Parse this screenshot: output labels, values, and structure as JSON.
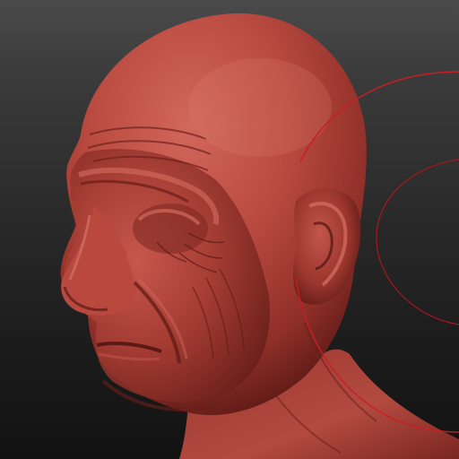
{
  "viewport": {
    "description_label": "",
    "background_top": "#4a4a4a",
    "background_bottom": "#121212"
  },
  "model": {
    "material_color": "#b3453c",
    "highlight_color": "#d96b5e",
    "shadow_color": "#5e1a16"
  },
  "gizmo": {
    "ring_color": "#c81e24"
  }
}
